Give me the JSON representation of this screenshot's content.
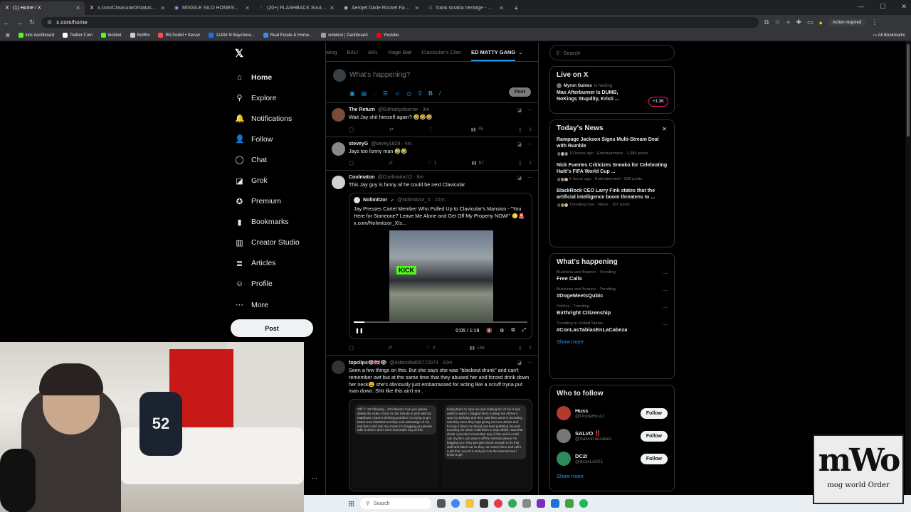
{
  "browser": {
    "tabs": [
      {
        "title": "(1) Home / X",
        "icon": "x-icon",
        "color": "#ffffff",
        "active": true
      },
      {
        "title": "x.com/Clavicular0/status/2039",
        "icon": "x-icon",
        "color": "#ffffff",
        "active": false
      },
      {
        "title": "MISSILE SILO HOMESTEAD - G",
        "icon": "globe-icon",
        "color": "#8ab4f8",
        "active": false
      },
      {
        "title": "(20+) FLASHBACK South Florid",
        "icon": "facebook-icon",
        "color": "#1877f2",
        "active": false
      },
      {
        "title": "Aerojet Dade Rocket Facility |",
        "icon": "link-icon",
        "color": "#bdc1c6",
        "active": false
      },
      {
        "title": "frank sinatra heritage - Google",
        "icon": "google-icon",
        "color": "#34a853",
        "active": false
      }
    ],
    "new_tab": "+",
    "url": "x.com/home",
    "action_required": "Action required",
    "bookmarks": [
      {
        "label": "kick dashboard",
        "color": "#53fc18"
      },
      {
        "label": "Twitter Com",
        "color": "#ffffff"
      },
      {
        "label": "kickbot",
        "color": "#53fc18"
      },
      {
        "label": "BotRix",
        "color": "#cccccc"
      },
      {
        "label": "IRLToolkit • Server",
        "color": "#ff4d4d"
      },
      {
        "label": "11404 N Bayshore...",
        "color": "#1a73e8"
      },
      {
        "label": "Real Estate & Home...",
        "color": "#4285f4"
      },
      {
        "label": "sidekick | Dashboard",
        "color": "#9aa0a6"
      },
      {
        "label": "Youtube",
        "color": "#ff0000"
      }
    ],
    "all_bookmarks": "All Bookmarks"
  },
  "nav": {
    "items": [
      {
        "label": "Home",
        "icon": "home-icon",
        "glyph": "⌂"
      },
      {
        "label": "Explore",
        "icon": "search-icon",
        "glyph": "⚲"
      },
      {
        "label": "Notifications",
        "icon": "bell-icon",
        "glyph": "🔔"
      },
      {
        "label": "Follow",
        "icon": "add-user-icon",
        "glyph": "👤"
      },
      {
        "label": "Chat",
        "icon": "chat-icon",
        "glyph": "◯"
      },
      {
        "label": "Grok",
        "icon": "grok-icon",
        "glyph": "◪"
      },
      {
        "label": "Premium",
        "icon": "premium-icon",
        "glyph": "✪"
      },
      {
        "label": "Bookmarks",
        "icon": "bookmark-icon",
        "glyph": "▮"
      },
      {
        "label": "Creator Studio",
        "icon": "creator-studio-icon",
        "glyph": "▥"
      },
      {
        "label": "Articles",
        "icon": "articles-icon",
        "glyph": "≣"
      },
      {
        "label": "Profile",
        "icon": "profile-icon",
        "glyph": "☺"
      },
      {
        "label": "More",
        "icon": "more-icon",
        "glyph": "⋯"
      }
    ],
    "post": "Post"
  },
  "feed": {
    "tabs": [
      "wing",
      "BAU",
      "ARL",
      "Rage Bait",
      "Clavicular's Clan",
      "ED MATTY GANG"
    ],
    "composer_placeholder": "What's happening?",
    "composer_post": "Post",
    "tweets": [
      {
        "name": "The Return",
        "handle": "@Edmattysburner · 3m",
        "text": "Wait Jay shit himself again? 🤣🤣🤣",
        "likes": "",
        "views": "45",
        "avatar": "#7a4a3a"
      },
      {
        "name": "steveyG",
        "handle": "@sevey1828 · 4m",
        "text": "Jays too funny man 🤣🤣",
        "likes": "1",
        "views": "57",
        "avatar": "#888888"
      },
      {
        "name": "Coolmaton",
        "handle": "@Coolmaton12 · 8m",
        "text": "This Jay guy is funny af he could be next Clavicular",
        "likes": "2",
        "views": "148",
        "avatar": "#d0d0d0"
      }
    ],
    "quote": {
      "name": "Nolimitzor",
      "handle": "@Nolimitzor_X · 21m",
      "text": "Jay Presses Cartel Member Who Pulled Up to Clavicular's Mansion - \"You Here for Someone? Leave Me Alone and Get Off My Property NOW!\" 😳🚨 x.com/NoIimitzor_X/s...",
      "video_time": "0:05 / 1:19",
      "kick_label": "KICK",
      "progress": 0.06
    },
    "tweet4": {
      "name": "topclips👁🇬🇧👁",
      "handle": "@AdamWal05772073 · 10m",
      "text": "Seen a few things on this. But she says she was \"blackout drunk\" and can't remember owt but at the same time that they abused her and forced drink down her neck😩 she's obviously just embarrassed for acting like a scruff tryna put man down. Shit like this ain't on .",
      "img_left": "Tiff 🖤  23 following · 43 followers  Can you please delete the video of me I'm the blonde in pink with Ed Matthews I have a drinking problem I'm trying to get better and I blacked out they took advantage of me and this could ruin my career I'm begging you please take it down I don't even remember any of this",
      "img_right": "telling them to rape me and making fun of me it was awful to watch I begged them to keep me off live it was my birthday and they said they weren't recording and they were they kept giving us more drinks and forcing it down my throat and kept grabbing me and touching me when I told them to stop whilst I was that drunk I just don't remember any of this and it could ruin my life I just want it off the internet please I'm begging you  They get girls drunk enough to do that stuff and black out so they can touch them and call it a job then record it and put it on the internet and I know a girl"
    }
  },
  "right": {
    "search_placeholder": "Search",
    "live": {
      "title": "Live on X",
      "host": "Myron Gaines",
      "host_suffix": "is hosting",
      "text": "Max Afterburner Is DUMB, NoKings Stupdity, Kristi ...",
      "count": "+1.3K"
    },
    "news": {
      "title": "Today's News",
      "close": "✕",
      "items": [
        {
          "title": "Rampage Jackson Signs Multi-Stream Deal with Rumble",
          "meta": "19 hours ago · Entertainment · 1,086 posts"
        },
        {
          "title": "Nick Fuentes Criticizes Sneako for Celebrating Haiti's FIFA World Cup ...",
          "meta": "6 hours ago · Entertainment · 556 posts"
        },
        {
          "title": "BlackRock CEO Larry Fink states that the artificial intelligence boom threatens to ...",
          "meta": "Trending now · News · 107 posts"
        }
      ]
    },
    "happening": {
      "title": "What's happening",
      "items": [
        {
          "category": "Business and finance · Trending",
          "name": "Free Calls"
        },
        {
          "category": "Business and finance · Trending",
          "name": "#DogeMeetsQubic"
        },
        {
          "category": "Politics · Trending",
          "name": "Birthright Citizenship"
        },
        {
          "category": "Trending in United States",
          "name": "#ConLasTablasEnLaCabeza"
        }
      ],
      "show_more": "Show more"
    },
    "who_to_follow": {
      "title": "Who to follow",
      "items": [
        {
          "name": "Huss",
          "handle": "@UncleHuss1",
          "color": "#b33a2e"
        },
        {
          "name": "SALVO ‼️",
          "handle": "@SalvoPancakes",
          "color": "#777777"
        },
        {
          "name": "DC2I",
          "handle": "@dcoxLA021",
          "color": "#2e8b57"
        }
      ],
      "follow": "Follow",
      "show_more": "Show more"
    }
  },
  "webcam": {
    "jersey": "52"
  },
  "taskbar": {
    "search": "Search"
  },
  "overlay_logo": {
    "big": "mWo",
    "small": "mog world Order"
  }
}
